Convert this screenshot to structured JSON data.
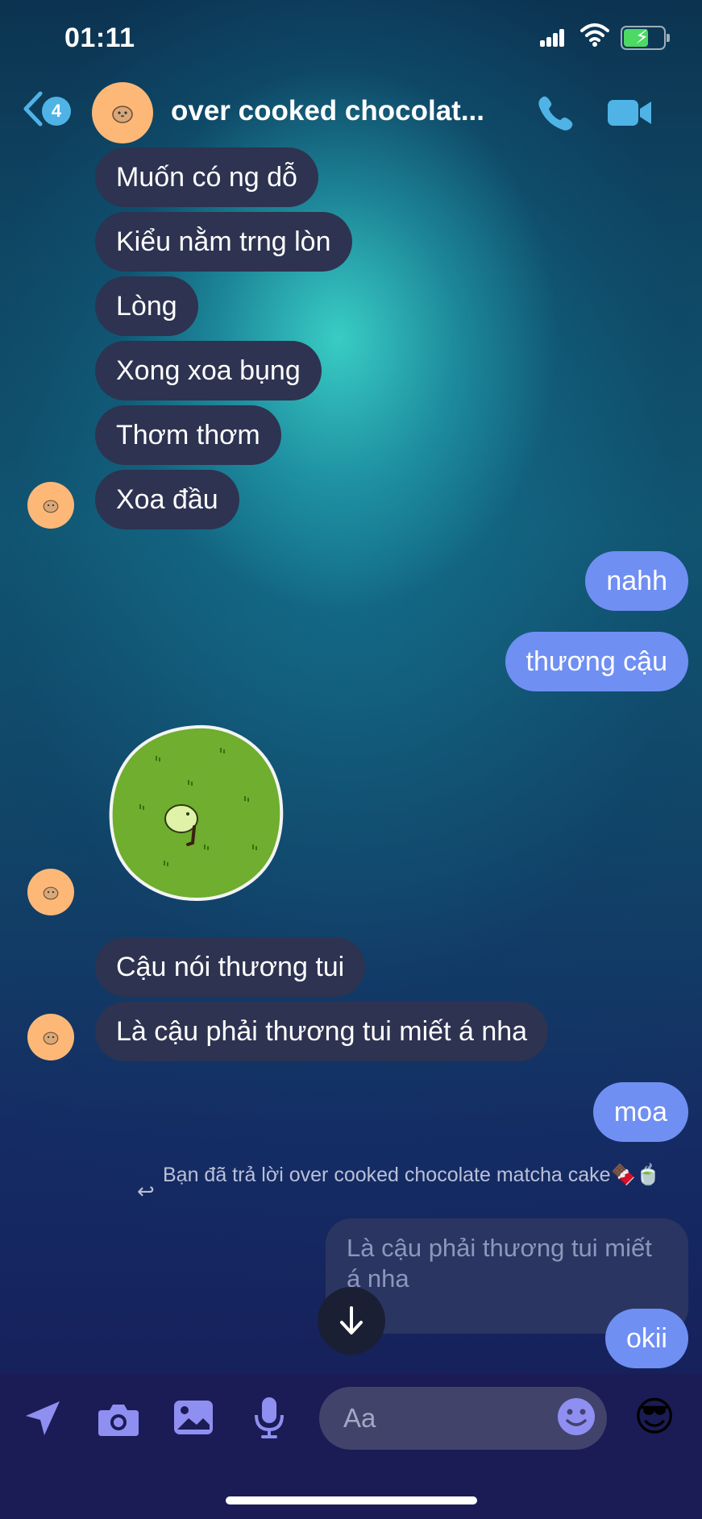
{
  "status_bar": {
    "time": "01:11"
  },
  "header": {
    "unread_count": "4",
    "title": "over cooked chocolat..."
  },
  "messages": {
    "incoming_group1": [
      "Muốn có ng dỗ",
      "Kiểu nằm trng lòn",
      "Lòng",
      "Xong xoa bụng",
      "Thơm thơm",
      "Xoa đầu"
    ],
    "outgoing_group1": [
      "nahh",
      "thương cậu"
    ],
    "incoming_group2": [
      "Cậu nói thương tui",
      "Là cậu phải thương tui miết á nha"
    ],
    "outgoing_moa": "moa",
    "reply_note": "Bạn đã trả lời over cooked chocolate matcha cake🍫🍵",
    "reply_quote": "Là cậu phải thương tui miết á nha",
    "outgoing_reply": "okii"
  },
  "composer": {
    "placeholder": "Aa",
    "quick_reaction": "😎"
  },
  "colors": {
    "incoming_bubble": "#2d3350",
    "outgoing_bubble": "#6f8ff3",
    "accent": "#4fb3e6"
  },
  "icons": [
    "chevron-left-icon",
    "phone-icon",
    "video-camera-icon",
    "location-arrow-icon",
    "camera-icon",
    "image-icon",
    "microphone-icon",
    "smiley-icon",
    "arrow-down-icon"
  ]
}
